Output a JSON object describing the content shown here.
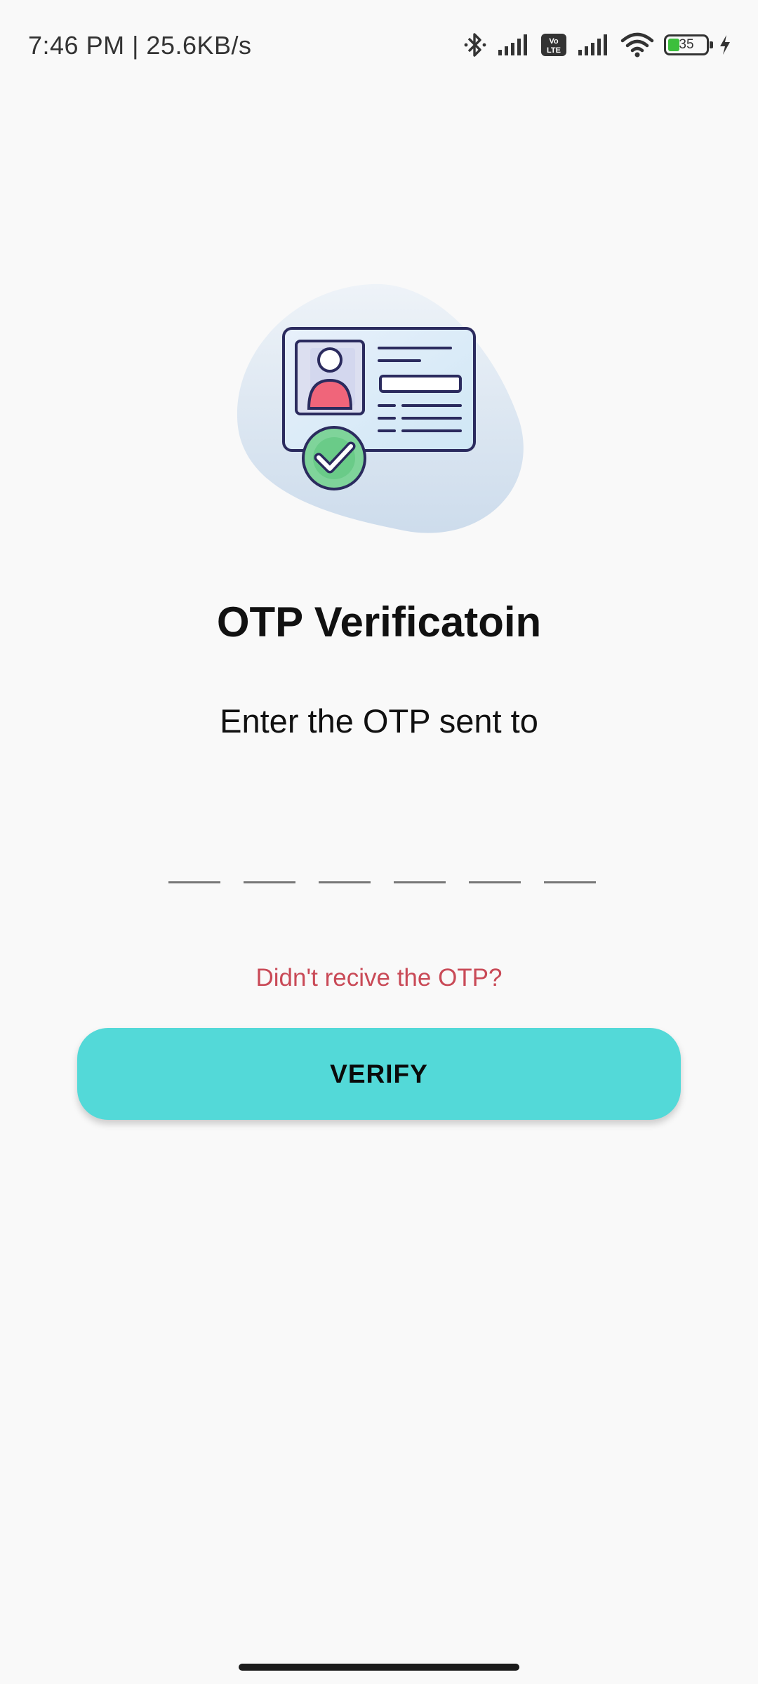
{
  "status_bar": {
    "time": "7:46 PM | 25.6KB/s",
    "battery_level": "35",
    "icons": [
      "bluetooth-icon",
      "signal-icon",
      "volte-icon",
      "signal-icon",
      "wifi-icon",
      "battery-icon",
      "charging-icon"
    ]
  },
  "illustration": {
    "icon": "id-card-verified-icon"
  },
  "screen": {
    "title": "OTP Verificatoin",
    "subtitle": "Enter the OTP sent to"
  },
  "otp": {
    "digits": [
      "",
      "",
      "",
      "",
      "",
      ""
    ]
  },
  "resend": {
    "label": "Didn't recive the OTP?"
  },
  "verify_button": {
    "label": "VERIFY"
  },
  "colors": {
    "accent": "#53d9d8",
    "resend_text": "#c94a57",
    "background": "#f9f9f9"
  }
}
